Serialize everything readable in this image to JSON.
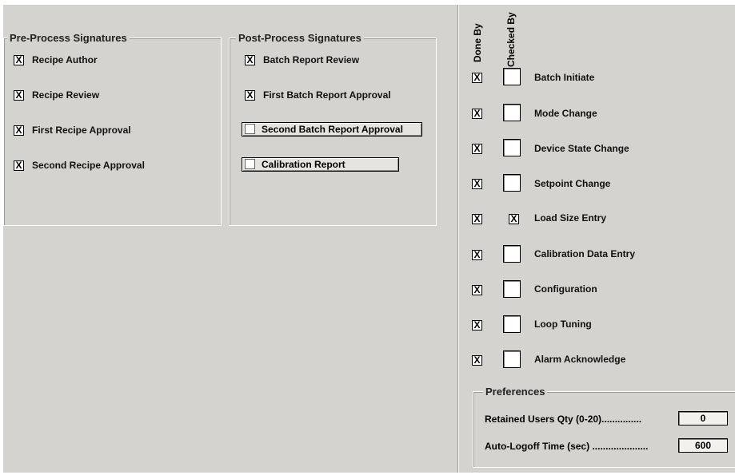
{
  "pre_process": {
    "title": "Pre-Process Signatures",
    "items": [
      {
        "label": "Recipe Author",
        "checked": true
      },
      {
        "label": "Recipe Review",
        "checked": true
      },
      {
        "label": "First Recipe Approval",
        "checked": true
      },
      {
        "label": "Second Recipe Approval",
        "checked": true
      }
    ]
  },
  "post_process": {
    "title": "Post-Process Signatures",
    "items": [
      {
        "label": "Batch Report Review",
        "checked": true
      },
      {
        "label": "First Batch Report Approval",
        "checked": true
      }
    ],
    "buttons": [
      {
        "label": "Second Batch Report Approval"
      },
      {
        "label": "Calibration Report"
      }
    ]
  },
  "events": {
    "done_by_header": "Done By",
    "checked_by_header": "Checked By",
    "rows": [
      {
        "label": "Batch Initiate",
        "done_by": true,
        "checked_by": false
      },
      {
        "label": "Mode Change",
        "done_by": true,
        "checked_by": false
      },
      {
        "label": "Device State Change",
        "done_by": true,
        "checked_by": false
      },
      {
        "label": "Setpoint Change",
        "done_by": true,
        "checked_by": false
      },
      {
        "label": "Load Size Entry",
        "done_by": true,
        "checked_by": true
      },
      {
        "label": "Calibration Data Entry",
        "done_by": true,
        "checked_by": false
      },
      {
        "label": "Configuration",
        "done_by": true,
        "checked_by": false
      },
      {
        "label": "Loop Tuning",
        "done_by": true,
        "checked_by": false
      },
      {
        "label": "Alarm Acknowledge",
        "done_by": true,
        "checked_by": false
      }
    ]
  },
  "preferences": {
    "title": "Preferences",
    "retained_users_label": "Retained Users Qty (0-20)...............",
    "retained_users_value": "0",
    "auto_logoff_label": "Auto-Logoff Time (sec) .....................",
    "auto_logoff_value": "600"
  },
  "check_mark": "X"
}
